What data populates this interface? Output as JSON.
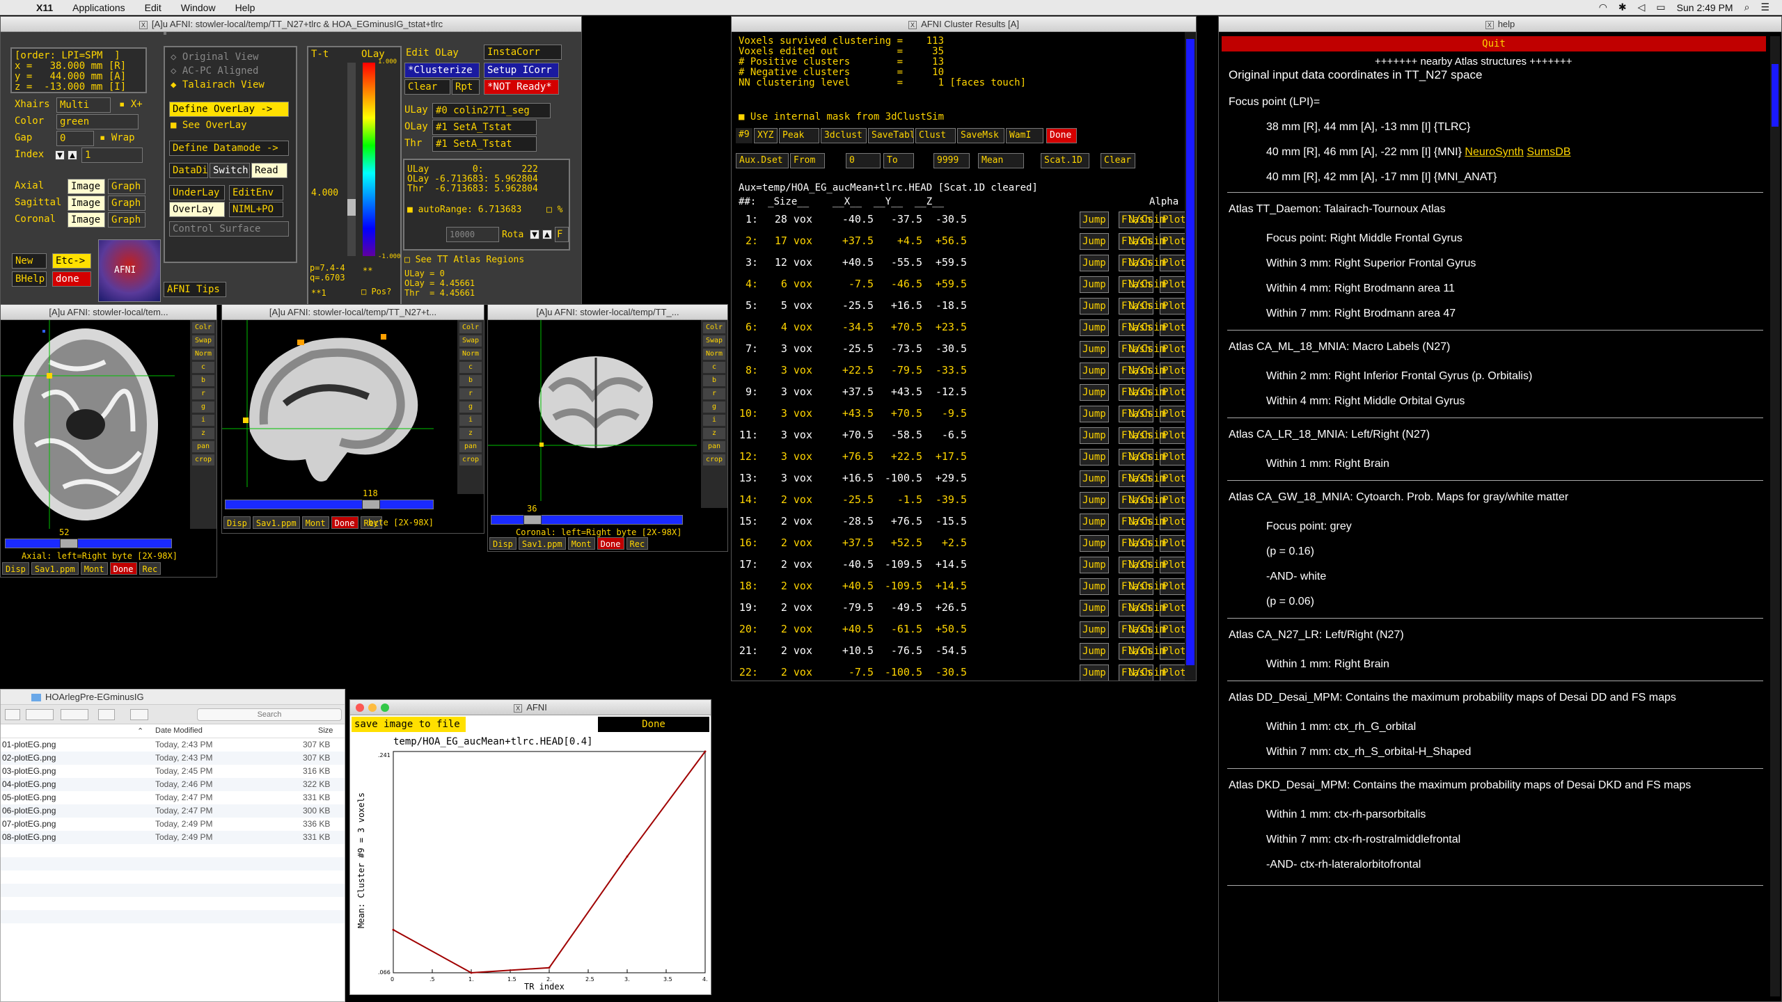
{
  "menubar": {
    "app": "X11",
    "items": [
      "Applications",
      "Edit",
      "Window",
      "Help"
    ],
    "clock": "Sun 2:49 PM"
  },
  "afni_main": {
    "title": "[A]u AFNI: stowler-local/temp/TT_N27+tlrc & HOA_EGminusIG_tstat+tlrc",
    "order": "[order: LPI=SPM  ]",
    "x": "x =   38.000 mm [R]",
    "y": "y =   44.000 mm [A]",
    "z": "z =  -13.000 mm [I]",
    "xhairs_label": "Xhairs",
    "xhairs_value": "Multi",
    "xplus": "X+",
    "color_label": "Color",
    "color_value": "green",
    "gap_label": "Gap",
    "gap_value": "0",
    "wrap": "Wrap",
    "index_label": "Index",
    "index_value": "1",
    "axial": "Axial",
    "sagittal": "Sagittal",
    "coronal": "Coronal",
    "image": "Image",
    "graph": "Graph",
    "new": "New",
    "etc": "Etc->",
    "bhelp": "BHelp",
    "done": "done",
    "logo": "AFNI",
    "tips": "AFNI Tips",
    "original_view": "Original View",
    "acpc": "AC-PC Aligned",
    "talairach": "Talairach View",
    "define_overlay": "Define OverLay ->",
    "see_overlay": "See OverLay",
    "define_datamode": "Define Datamode ->",
    "datadir": "DataDir",
    "switch": "Switch",
    "read": "Read",
    "underlay": "UnderLay",
    "editenv": "EditEnv",
    "overlay": "OverLay",
    "nimlpo": "NIML+PO",
    "control_surface": "Control Surface",
    "tt": "T-t",
    "olay": "OLay",
    "edit_olay": "Edit OLay",
    "instacorr": "InstaCorr",
    "clusterize": "*Clusterize",
    "setup_icorr": "Setup ICorr",
    "clear": "Clear",
    "rpt": "Rpt",
    "not_ready": "*NOT Ready*",
    "ulay_label": "ULay",
    "ulay_value": "#0 colin27T1_seg",
    "olay_label": "OLay",
    "olay_value": "#1 SetA_Tstat",
    "thr_label": "Thr",
    "thr_value": "#1 SetA_Tstat",
    "ulay_read": "ULay        0:       222",
    "olay_read": "OLay -6.713683: 5.962804",
    "thr_read": "Thr  -6.713683: 5.962804",
    "autorange": "autoRange: 6.713683",
    "pct": "%",
    "scale_top": "1.000",
    "scale_bot": "-1.000",
    "thresh_val": "4.000",
    "pval": "p=7.4-4",
    "qval": "q=.6703",
    "rng": "10000",
    "rota": "Rota",
    "f": "F",
    "see_tt": "See TT Atlas Regions",
    "ulay0": "ULay = 0",
    "olay_v": "OLay = 4.45661",
    "thr_v": "Thr  = 4.45661",
    "pos": "Pos?",
    "star1": "**1",
    "star2": "**"
  },
  "viewers": [
    {
      "title": "[A]u AFNI: stowler-local/tem...",
      "label": "Axial: left=Right byte [2X-98X]",
      "slice": "52"
    },
    {
      "title": "[A]u AFNI: stowler-local/temp/TT_N27+t...",
      "label": "byte [2X-98X]",
      "slice": "118"
    },
    {
      "title": "[A]u AFNI: stowler-local/temp/TT_...",
      "label": "Coronal: left=Right byte [2X-98X]",
      "slice": "36"
    }
  ],
  "viewer_side": [
    "Colr",
    "Swap",
    "Norm",
    "c",
    "b",
    "r",
    "g",
    "i",
    "z",
    "pan",
    "crop"
  ],
  "viewer_bottom": [
    "Disp",
    "Sav1.ppm",
    "Mont",
    "Done",
    "Rec"
  ],
  "cluster": {
    "title": "AFNI Cluster Results [A]",
    "summary": [
      "Voxels survived clustering =    113",
      "Voxels edited out          =     35",
      "# Positive clusters        =     13",
      "# Negative clusters        =     10",
      "NN clustering level        =      1 [faces touch]"
    ],
    "mask_label": "Use internal mask from 3dClustSim",
    "bar1": [
      "#9",
      "XYZ",
      "Peak",
      "3dclust",
      "SaveTabl",
      "Clust",
      "SaveMsk",
      "WamI",
      "Done"
    ],
    "bar2": [
      "Aux.Dset",
      "From",
      "0",
      "To",
      "9999",
      "Mean",
      "Scat.1D",
      "Clear"
    ],
    "aux": "Aux=temp/HOA_EG_aucMean+tlrc.HEAD [Scat.1D cleared]",
    "header": "##:  _Size__    __X__  __Y__  __Z__                                   Alpha",
    "row_buttons": [
      "Jump",
      "Flash",
      "Plot",
      "Save"
    ],
    "alpha": "N/Csim",
    "rows": [
      [
        "1:",
        "28 vox",
        "-40.5",
        "-37.5",
        "-30.5"
      ],
      [
        "2:",
        "17 vox",
        "+37.5",
        "+4.5",
        "+56.5"
      ],
      [
        "3:",
        "12 vox",
        "+40.5",
        "-55.5",
        "+59.5"
      ],
      [
        "4:",
        "6 vox",
        "-7.5",
        "-46.5",
        "+59.5"
      ],
      [
        "5:",
        "5 vox",
        "-25.5",
        "+16.5",
        "-18.5"
      ],
      [
        "6:",
        "4 vox",
        "-34.5",
        "+70.5",
        "+23.5"
      ],
      [
        "7:",
        "3 vox",
        "-25.5",
        "-73.5",
        "-30.5"
      ],
      [
        "8:",
        "3 vox",
        "+22.5",
        "-79.5",
        "-33.5"
      ],
      [
        "9:",
        "3 vox",
        "+37.5",
        "+43.5",
        "-12.5"
      ],
      [
        "10:",
        "3 vox",
        "+43.5",
        "+70.5",
        "-9.5"
      ],
      [
        "11:",
        "3 vox",
        "+70.5",
        "-58.5",
        "-6.5"
      ],
      [
        "12:",
        "3 vox",
        "+76.5",
        "+22.5",
        "+17.5"
      ],
      [
        "13:",
        "3 vox",
        "+16.5",
        "-100.5",
        "+29.5"
      ],
      [
        "14:",
        "2 vox",
        "-25.5",
        "-1.5",
        "-39.5"
      ],
      [
        "15:",
        "2 vox",
        "-28.5",
        "+76.5",
        "-15.5"
      ],
      [
        "16:",
        "2 vox",
        "+37.5",
        "+52.5",
        "+2.5"
      ],
      [
        "17:",
        "2 vox",
        "-40.5",
        "-109.5",
        "+14.5"
      ],
      [
        "18:",
        "2 vox",
        "+40.5",
        "-109.5",
        "+14.5"
      ],
      [
        "19:",
        "2 vox",
        "-79.5",
        "-49.5",
        "+26.5"
      ],
      [
        "20:",
        "2 vox",
        "+40.5",
        "-61.5",
        "+50.5"
      ],
      [
        "21:",
        "2 vox",
        "+10.5",
        "-76.5",
        "-54.5"
      ],
      [
        "22:",
        "2 vox",
        "-7.5",
        "-100.5",
        "-30.5"
      ]
    ]
  },
  "help": {
    "title": "help",
    "quit": "Quit",
    "heading": "+++++++ nearby Atlas structures +++++++",
    "subheading": "Original input data coordinates in TT_N27 space",
    "focus_lpi": "Focus point (LPI)=",
    "coord1": "38 mm [R], 44 mm [A], -13 mm [I] {TLRC}",
    "coord2_pre": "40 mm [R], 46 mm [A], -22 mm [I] {MNI}",
    "neurosynth": "NeuroSynth",
    "sumsdb": "SumsDB",
    "coord3": "40 mm [R], 42 mm [A], -17 mm [I] {MNI_ANAT}",
    "sections": [
      {
        "title": "Atlas TT_Daemon: Talairach-Tournoux Atlas",
        "lines": [
          "Focus point: Right Middle Frontal Gyrus",
          "Within 3 mm: Right Superior Frontal Gyrus",
          "Within 4 mm: Right Brodmann area 11",
          "Within 7 mm: Right Brodmann area 47"
        ]
      },
      {
        "title": "Atlas CA_ML_18_MNIA: Macro Labels (N27)",
        "lines": [
          "Within 2 mm: Right Inferior Frontal Gyrus (p. Orbitalis)",
          "Within 4 mm: Right Middle Orbital Gyrus"
        ]
      },
      {
        "title": "Atlas CA_LR_18_MNIA: Left/Right (N27)",
        "lines": [
          "Within 1 mm: Right Brain"
        ]
      },
      {
        "title": "Atlas CA_GW_18_MNIA: Cytoarch. Prob. Maps for gray/white matter",
        "lines": [
          "Focus point: grey",
          "(p = 0.16)",
          "-AND- white",
          "(p = 0.06)"
        ]
      },
      {
        "title": "Atlas CA_N27_LR: Left/Right (N27)",
        "lines": [
          "Within 1 mm: Right Brain"
        ]
      },
      {
        "title": "Atlas DD_Desai_MPM: Contains the maximum probability maps of Desai DD and FS maps",
        "lines": [
          "Within 1 mm: ctx_rh_G_orbital",
          "Within 7 mm: ctx_rh_S_orbital-H_Shaped"
        ]
      },
      {
        "title": "Atlas DKD_Desai_MPM: Contains the maximum probability maps of Desai DKD and FS maps",
        "lines": [
          "Within 1 mm: ctx-rh-parsorbitalis",
          "Within 7 mm: ctx-rh-rostralmiddlefrontal",
          "-AND- ctx-rh-lateralorbitofrontal"
        ]
      }
    ]
  },
  "finder": {
    "title": "HOArlegPre-EGminusIG",
    "search_placeholder": "Search",
    "col_modified": "Date Modified",
    "col_size": "Size",
    "files": [
      {
        "name": "01-plotEG.png",
        "date": "Today, 2:43 PM",
        "size": "307 KB"
      },
      {
        "name": "02-plotEG.png",
        "date": "Today, 2:43 PM",
        "size": "307 KB"
      },
      {
        "name": "03-plotEG.png",
        "date": "Today, 2:45 PM",
        "size": "316 KB"
      },
      {
        "name": "04-plotEG.png",
        "date": "Today, 2:46 PM",
        "size": "322 KB"
      },
      {
        "name": "05-plotEG.png",
        "date": "Today, 2:47 PM",
        "size": "331 KB"
      },
      {
        "name": "06-plotEG.png",
        "date": "Today, 2:47 PM",
        "size": "300 KB"
      },
      {
        "name": "07-plotEG.png",
        "date": "Today, 2:49 PM",
        "size": "336 KB"
      },
      {
        "name": "08-plotEG.png",
        "date": "Today, 2:49 PM",
        "size": "331 KB"
      }
    ]
  },
  "plot": {
    "title": "AFNI",
    "save_btn": "save image to file",
    "done_btn": "Done",
    "plot_title": "temp/HOA_EG_aucMean+tlrc.HEAD[0.4]",
    "xlabel": "TR index",
    "ylabel": "Mean: Cluster #9 = 3 voxels",
    "ytop": ".241",
    "ybot": ".066",
    "xticks": [
      "0",
      ".5",
      "1.",
      "1.5",
      "2.",
      "2.5",
      "3.",
      "3.5",
      "4."
    ]
  },
  "chart_data": {
    "type": "line",
    "title": "temp/HOA_EG_aucMean+tlrc.HEAD[0.4]",
    "xlabel": "TR index",
    "ylabel": "Mean: Cluster #9 = 3 voxels",
    "x": [
      0,
      1,
      2,
      3,
      4
    ],
    "values": [
      0.1,
      0.066,
      0.07,
      0.158,
      0.241
    ],
    "xlim": [
      0,
      4
    ],
    "ylim": [
      0.066,
      0.241
    ],
    "color": "#a00000"
  }
}
